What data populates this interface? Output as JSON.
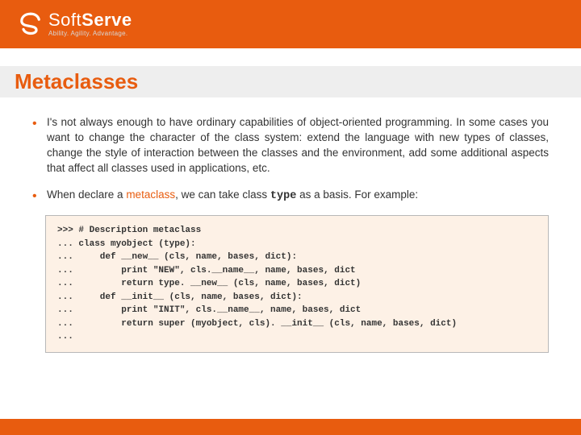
{
  "brand": {
    "name_soft": "Soft",
    "name_serve": "Serve",
    "tagline": "Ability. Agility. Advantage."
  },
  "title": "Metaclasses",
  "bullets": {
    "b1": "I's not always enough to have ordinary capabilities of object-oriented programming. In some cases you want to change the character of the class system: extend the language with new types of classes, change the style of interaction between the classes and the environment, add some additional aspects that affect all classes  used in applications, etc.",
    "b2_pre": "When declare a ",
    "b2_kw": "metaclass",
    "b2_mid": ", we can take class ",
    "b2_code": "type",
    "b2_post": " as a basis. For example:"
  },
  "code": ">>> # Description metaclass\n... class myobject (type):\n...     def __new__ (cls, name, bases, dict):\n...         print \"NEW\", cls.__name__, name, bases, dict\n...         return type. __new__ (cls, name, bases, dict)\n...     def __init__ (cls, name, bases, dict):\n...         print \"INIT\", cls.__name__, name, bases, dict\n...         return super (myobject, cls). __init__ (cls, name, bases, dict)\n..."
}
